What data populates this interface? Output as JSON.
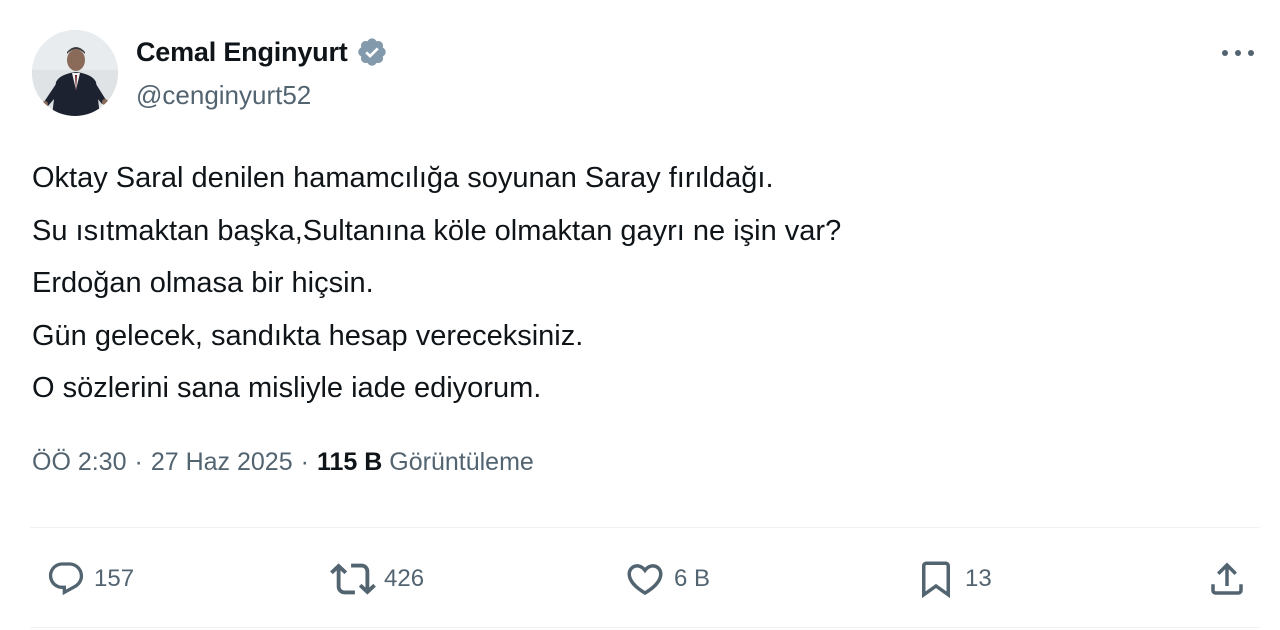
{
  "author": {
    "display_name": "Cemal Enginyurt",
    "handle": "@cenginyurt52",
    "avatar_icon": "profile-photo",
    "verified_icon": "verified-badge-icon",
    "verified_color": "#1d9bf0"
  },
  "more_icon": "more-options-icon",
  "tweet": {
    "lines": [
      "Oktay Saral denilen hamamcılığa soyunan Saray fırıldağı.",
      "Su ısıtmaktan başka,Sultanına köle olmaktan gayrı ne işin var?",
      "Erdoğan olmasa bir hiçsin.",
      "Gün gelecek, sandıkta hesap vereceksiniz.",
      "O sözlerini sana misliyle iade ediyorum."
    ]
  },
  "meta": {
    "time": "ÖÖ 2:30",
    "separator": "·",
    "date": "27 Haz 2025",
    "views_count": "115 B",
    "views_label": "Görüntüleme"
  },
  "actions": {
    "reply": {
      "icon": "reply-icon",
      "count": "157"
    },
    "retweet": {
      "icon": "retweet-icon",
      "count": "426"
    },
    "like": {
      "icon": "heart-icon",
      "count": "6 B"
    },
    "bookmark": {
      "icon": "bookmark-icon",
      "count": "13"
    },
    "share": {
      "icon": "share-icon"
    }
  },
  "colors": {
    "text_primary": "#0f1419",
    "text_secondary": "#536471",
    "divider": "#eff3f4"
  }
}
